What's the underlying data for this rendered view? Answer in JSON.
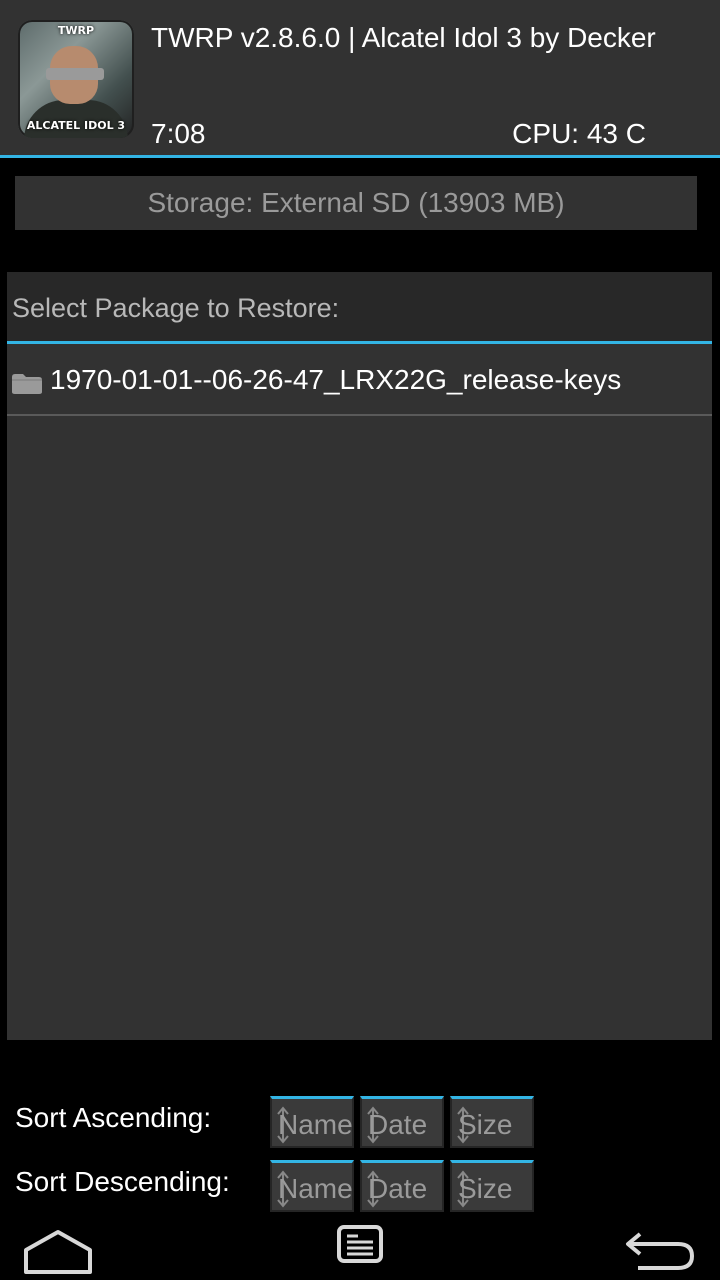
{
  "header": {
    "title": "TWRP v2.8.6.0 | Alcatel Idol 3 by Decker",
    "time": "7:08",
    "cpu": "CPU: 43 C",
    "logo": {
      "top_text": "TWRP",
      "bottom_text": "ALCATEL IDOL 3"
    }
  },
  "storage": {
    "label": "Storage: External SD (13903 MB)"
  },
  "package_list": {
    "header": "Select Package to Restore:",
    "items": [
      {
        "label": "1970-01-01--06-26-47_LRX22G_release-keys",
        "icon": "folder-icon"
      }
    ]
  },
  "sort": {
    "ascending_label": "Sort Ascending:",
    "descending_label": "Sort Descending:",
    "buttons": [
      "Name",
      "Date",
      "Size"
    ]
  },
  "nav": {
    "home_icon": "home-icon",
    "console_icon": "console-icon",
    "back_icon": "back-icon"
  },
  "colors": {
    "accent": "#33b5e5",
    "panel": "#323232",
    "background": "#000000"
  }
}
